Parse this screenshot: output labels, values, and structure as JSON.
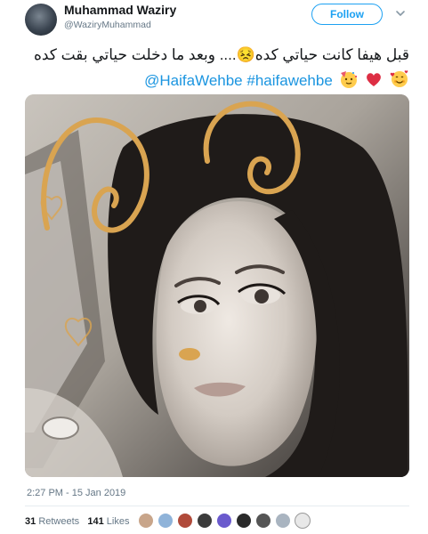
{
  "author": {
    "display_name": "Muhammad Waziry",
    "handle": "@WaziryMuhammad"
  },
  "actions": {
    "follow_label": "Follow"
  },
  "tweet": {
    "text_line1": "قبل هيفا كانت حياتي كده😣.... وبعد ما دخلت حياتي بقت كده",
    "mention": "@HaifaWehbe",
    "hashtag": "#haifawehbe",
    "emojis": [
      "partying-face",
      "red-heart",
      "smiling-face-with-hearts"
    ]
  },
  "meta": {
    "timestamp": "2:27 PM - 15 Jan 2019"
  },
  "stats": {
    "retweets_count": "31",
    "retweets_label": "Retweets",
    "likes_count": "141",
    "likes_label": "Likes"
  },
  "colors": {
    "link_blue": "#1b95e0",
    "follow_blue": "#1da1f2",
    "secondary_gray": "#657786",
    "snapchat_ear_gold": "#d9a451"
  }
}
